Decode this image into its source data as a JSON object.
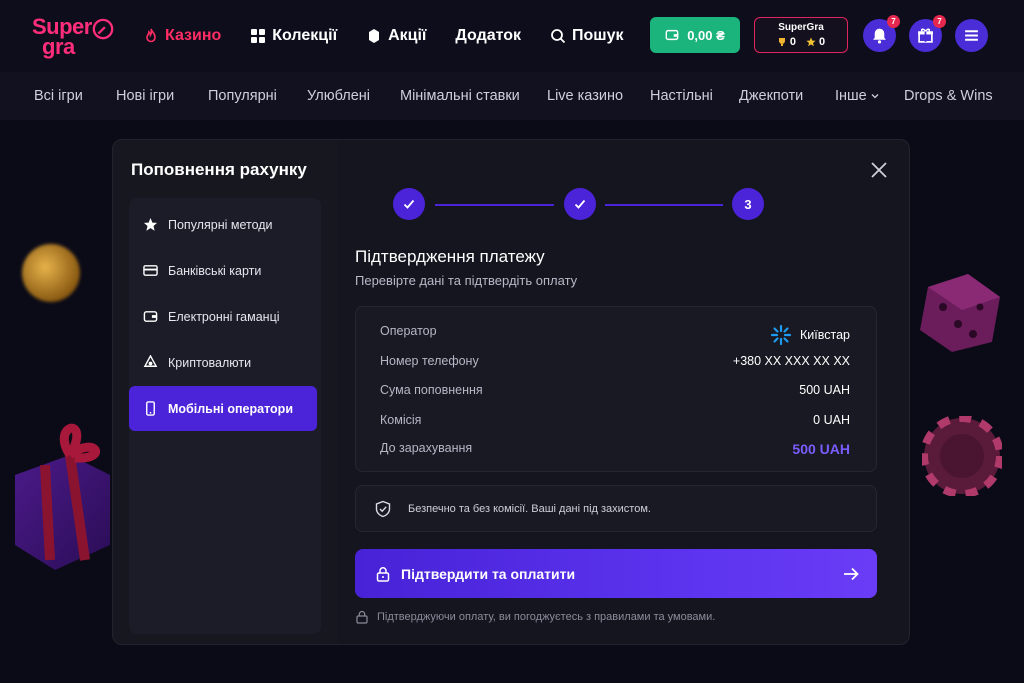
{
  "header": {
    "logo_top": "Super",
    "logo_bottom": "gra",
    "nav": [
      {
        "label": "Казино",
        "icon": "flame-icon"
      },
      {
        "label": "Колекції",
        "icon": "grid-icon"
      },
      {
        "label": "Акції",
        "icon": "gift-icon"
      },
      {
        "label": "Додаток",
        "icon": ""
      },
      {
        "label": "Пошук",
        "icon": "search-icon"
      }
    ],
    "balance": "0,00 ₴",
    "supergra": {
      "title": "SuperGra",
      "trophies": "0",
      "stars": "0"
    },
    "notifications_badge": "7",
    "gifts_badge": "7"
  },
  "categories": [
    "Всі ігри",
    "Нові ігри",
    "Популярні",
    "Улюблені",
    "Мінімальні ставки",
    "Live казино",
    "Настільні",
    "Джекпоти",
    "Інше",
    "Drops & Wins"
  ],
  "modal": {
    "title": "Поповнення рахунку",
    "methods": [
      {
        "label": "Популярні методи",
        "icon": "star-icon"
      },
      {
        "label": "Банківські карти",
        "icon": "card-icon"
      },
      {
        "label": "Електронні гаманці",
        "icon": "wallet-icon"
      },
      {
        "label": "Криптовалюти",
        "icon": "crypto-icon"
      },
      {
        "label": "Мобільні оператори",
        "icon": "phone-icon"
      }
    ],
    "step3_label": "3",
    "section_title": "Підтвердження платежу",
    "section_subtitle": "Перевірте дані та підтвердіть оплату",
    "summary": [
      {
        "key": "Оператор",
        "value": "Київстар"
      },
      {
        "key": "Номер телефону",
        "value": "+380 XX XXX XX XX"
      },
      {
        "key": "Сума поповнення",
        "value": "500 UAH"
      },
      {
        "key": "Комісія",
        "value": "0 UAH"
      },
      {
        "key": "До зарахування",
        "value": "500 UAH"
      }
    ],
    "secure_text": "Безпечно та без комісії. Ваші дані під захистом.",
    "pay_button": "Підтвердити та оплатити",
    "terms": "Підтверджуючи оплату, ви погоджуєтесь з правилами та умовами."
  },
  "colors": {
    "accent": "#4b23d8",
    "brand": "#ff2d7a",
    "wallet": "#1ab47c",
    "total": "#7b5cff"
  }
}
